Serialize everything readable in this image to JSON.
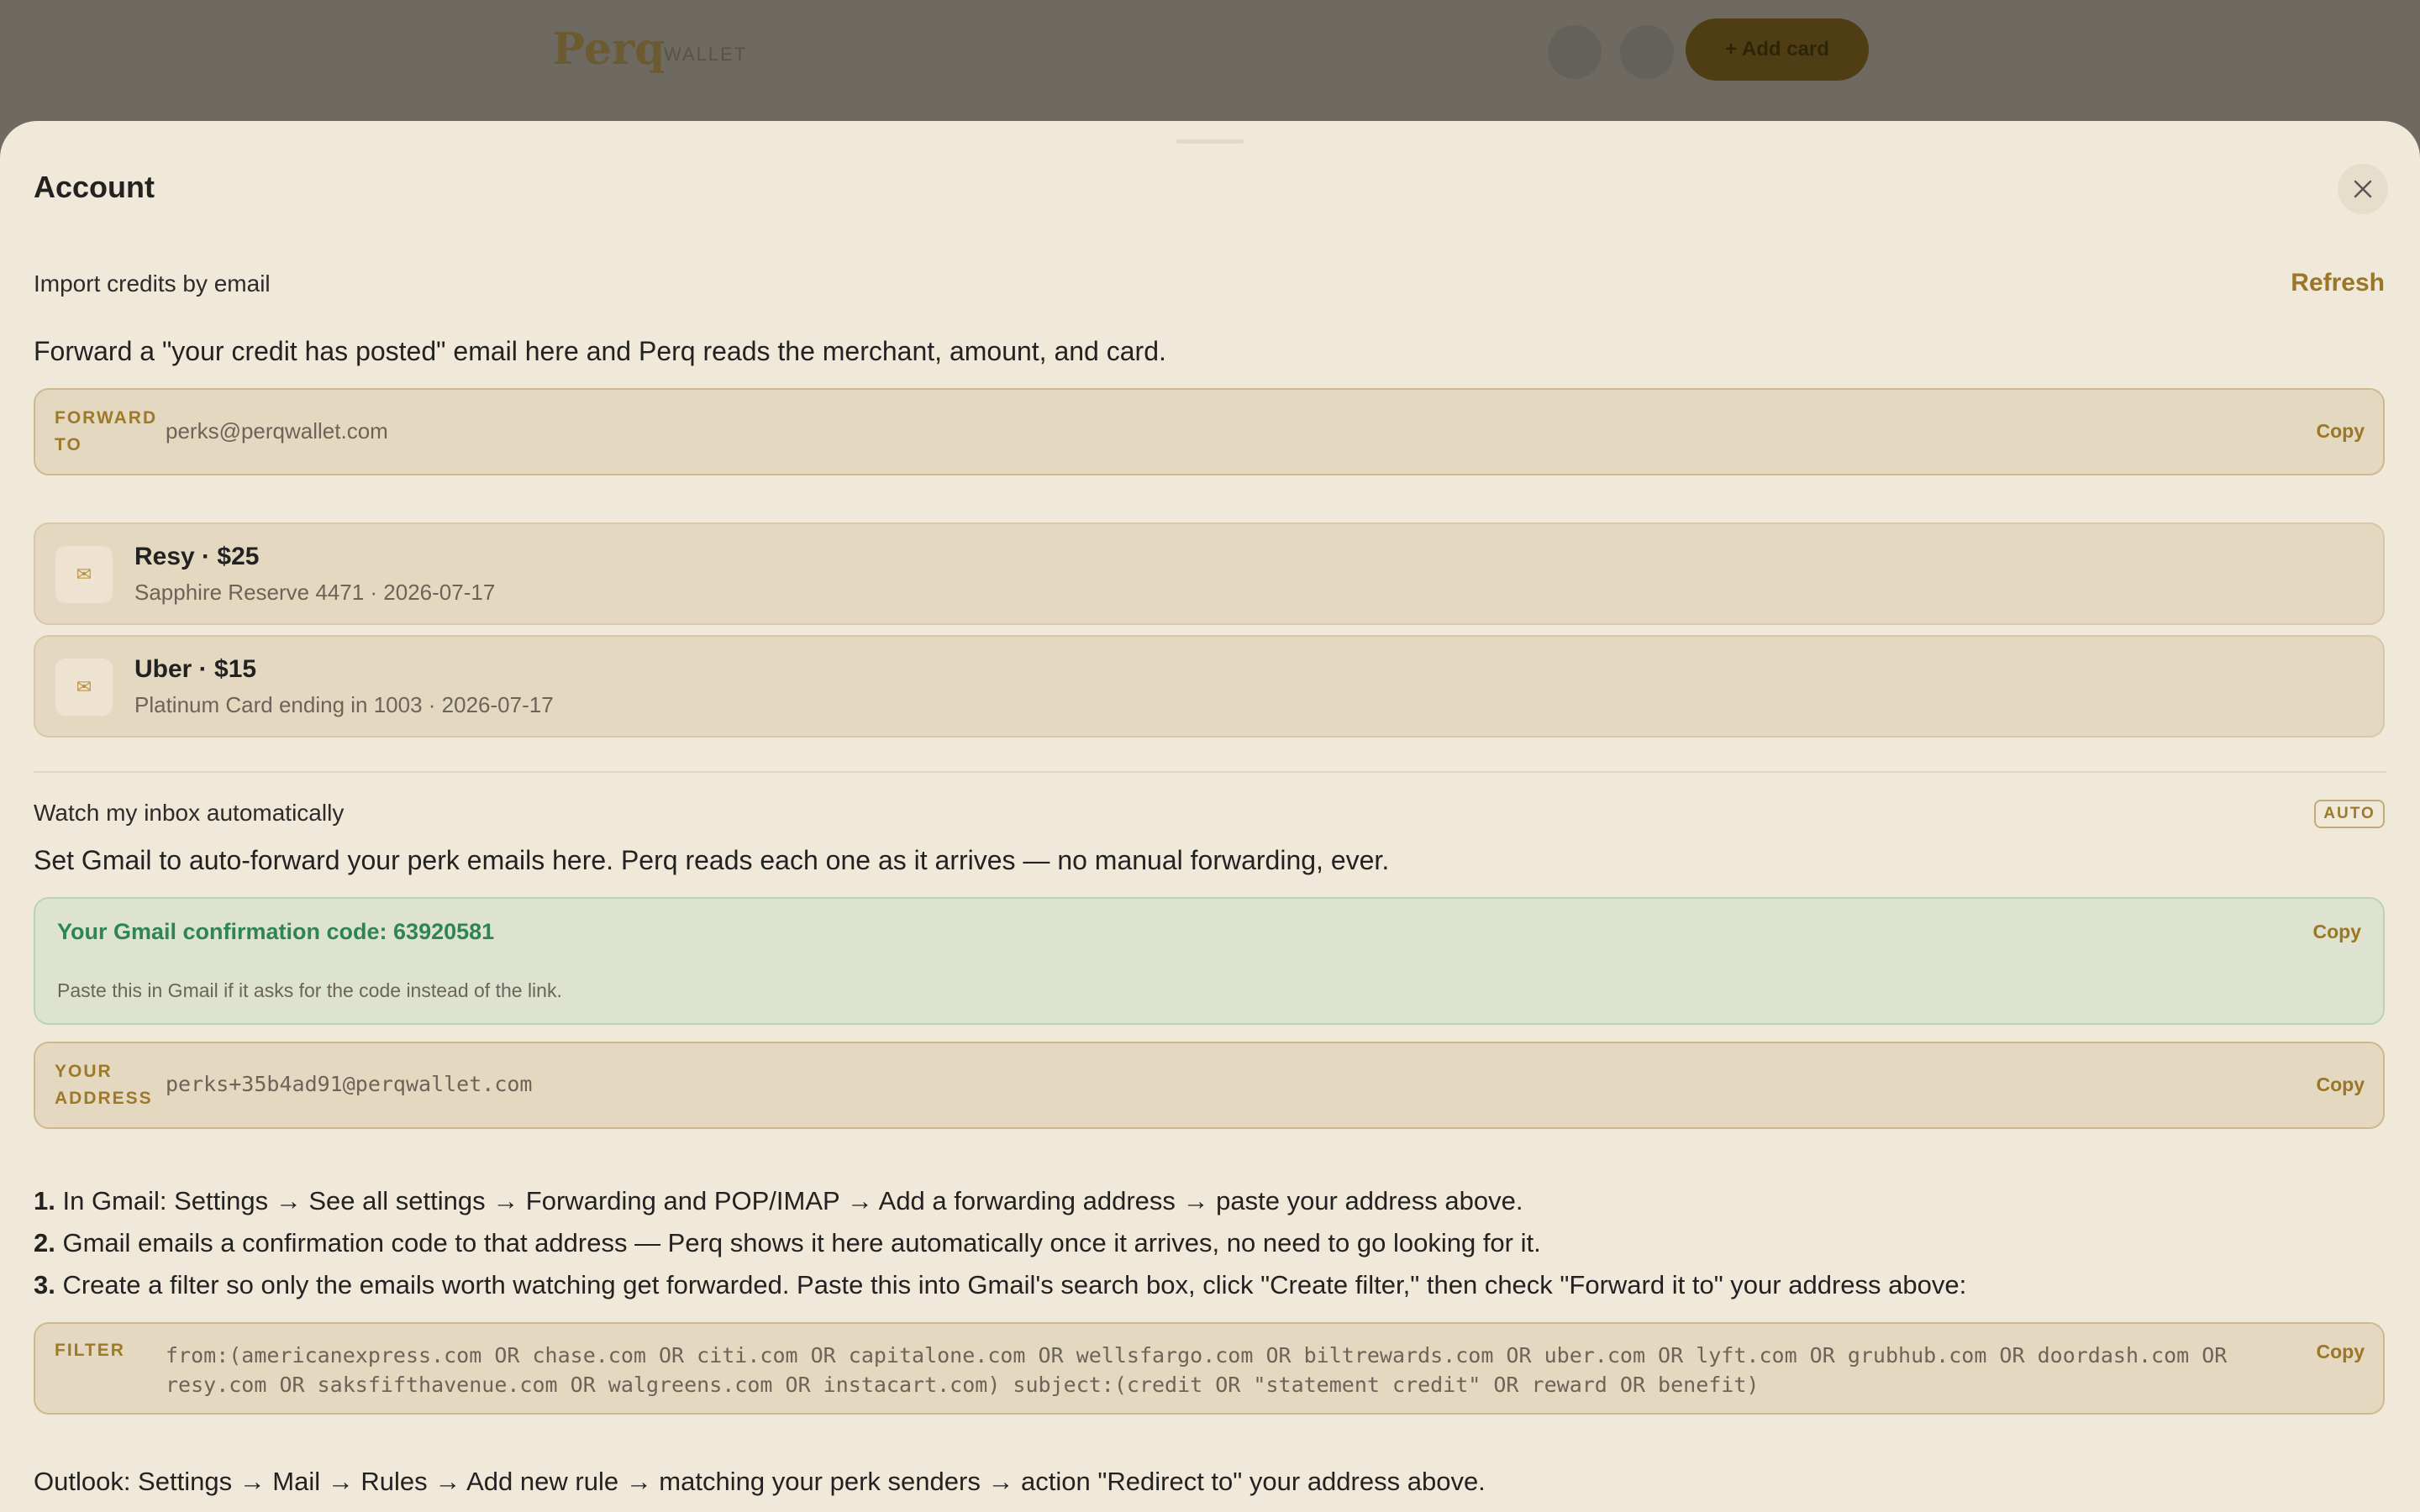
{
  "background": {
    "logo": "Perq",
    "logo_sub": "WALLET",
    "button_label": "+ Add card"
  },
  "sheet": {
    "title": "Account"
  },
  "import_section": {
    "label": "Import credits by email",
    "refresh_label": "Refresh",
    "description": "Forward a \"your credit has posted\" email here and Perq reads the merchant, amount, and card.",
    "forward_tag_line1": "FORWARD",
    "forward_tag_line2": "TO",
    "forward_address": "perks@perqwallet.com",
    "copy_label": "Copy",
    "credits": [
      {
        "icon": "envelope-icon",
        "title": "Resy · $25",
        "subtitle": "Sapphire Reserve 4471 · 2026-07-17"
      },
      {
        "icon": "envelope-icon",
        "title": "Uber · $15",
        "subtitle": "Platinum Card ending in 1003 · 2026-07-17"
      }
    ]
  },
  "watch_section": {
    "label": "Watch my inbox automatically",
    "badge": "AUTO",
    "description": "Set Gmail to auto-forward your perk emails here. Perq reads each one as it arrives — no manual forwarding, ever.",
    "confirmation_title": "Your Gmail confirmation code: 63920581",
    "confirmation_hint": "Paste this in Gmail if it asks for the code instead of the link.",
    "confirmation_copy": "Copy",
    "address_tag_line1": "YOUR",
    "address_tag_line2": "ADDRESS",
    "address_value": "perks+35b4ad91@perqwallet.com",
    "address_copy": "Copy",
    "steps": [
      {
        "num": "1.",
        "text": " In Gmail: Settings → See all settings → Forwarding and POP/IMAP → Add a forwarding address → paste your address above."
      },
      {
        "num": "2.",
        "text": " Gmail emails a confirmation code to that address — Perq shows it here automatically once it arrives, no need to go looking for it."
      },
      {
        "num": "3.",
        "text": " Create a filter so only the emails worth watching get forwarded. Paste this into Gmail's search box, click \"Create filter,\" then check \"Forward it to\" your address above:"
      }
    ],
    "filter_tag": "FILTER",
    "filter_value": "from:(americanexpress.com OR chase.com OR citi.com OR capitalone.com OR wellsfargo.com OR biltrewards.com OR uber.com OR lyft.com OR grubhub.com OR doordash.com OR resy.com OR saksfifthavenue.com OR walgreens.com OR instacart.com) subject:(credit OR \"statement credit\" OR reward OR benefit)",
    "filter_copy": "Copy",
    "outlook_text": "Outlook: Settings → Mail → Rules → Add new rule → matching your perk senders → action \"Redirect to\" your address above."
  }
}
